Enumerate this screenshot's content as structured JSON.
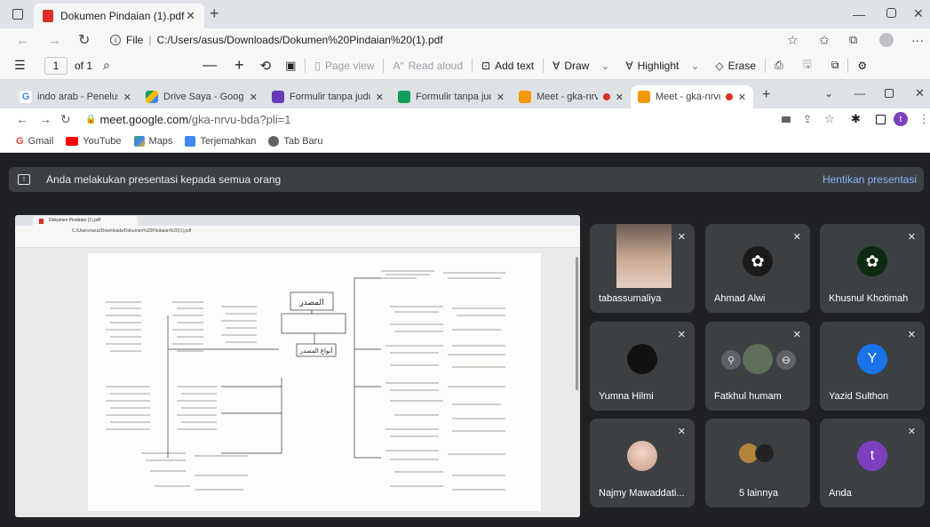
{
  "edge": {
    "tab_title": "Dokumen Pindaian (1).pdf",
    "addr_prefix": "File",
    "url": "C:/Users/asus/Downloads/Dokumen%20Pindaian%20(1).pdf"
  },
  "pdf_toolbar": {
    "page_number": "1",
    "page_of": "of 1",
    "page_view": "Page view",
    "read_aloud": "Read aloud",
    "add_text": "Add text",
    "draw": "Draw",
    "highlight": "Highlight",
    "erase": "Erase"
  },
  "chrome": {
    "tabs": [
      {
        "label": "indo arab - Penelusur",
        "color": "#4285f4"
      },
      {
        "label": "Drive Saya - Google D",
        "color": "#fbbc04"
      },
      {
        "label": "Formulir tanpa judul",
        "color": "#673ab7"
      },
      {
        "label": "Formulir tanpa judul",
        "color": "#0f9d58"
      },
      {
        "label": "Meet - gka-nrvu-",
        "color": "#f29900"
      },
      {
        "label": "Meet - gka-nrvu-",
        "color": "#f29900"
      }
    ],
    "url_host": "meet.google.com",
    "url_path": "/gka-nrvu-bda?pli=1",
    "bookmarks": [
      "Gmail",
      "YouTube",
      "Maps",
      "Terjemahkan",
      "Tab Baru"
    ],
    "profile_initial": "t"
  },
  "meet": {
    "presenting_text": "Anda melakukan presentasi kepada semua orang",
    "stop_label": "Hentikan presentasi",
    "participants": [
      {
        "name": "tabassumaliya",
        "avatar": "photo"
      },
      {
        "name": "Ahmad Alwi",
        "avatar": "flower"
      },
      {
        "name": "Khusnul Khotimah",
        "avatar": "flower"
      },
      {
        "name": "Yumna Hilmi",
        "avatar": "photo"
      },
      {
        "name": "Fatkhul humam",
        "avatar": "photo"
      },
      {
        "name": "Yazid Sulthon",
        "avatar": "Y",
        "avatar_color": "#1a73e8"
      },
      {
        "name": "Najmy Mawaddati...",
        "avatar": "photo"
      },
      {
        "name": "5 lainnya",
        "avatar": "group"
      },
      {
        "name": "Anda",
        "avatar": "t",
        "avatar_color": "#7b3fbf"
      }
    ]
  },
  "shared_doc": {
    "tab_title": "Dokumen Pindaian (1).pdf",
    "url": "C:/Users/asus/Downloads/Dokumen%20Pindaian%20(1).pdf",
    "center_title": "المصدر",
    "center_subtitle": "أنواع المصدر"
  }
}
